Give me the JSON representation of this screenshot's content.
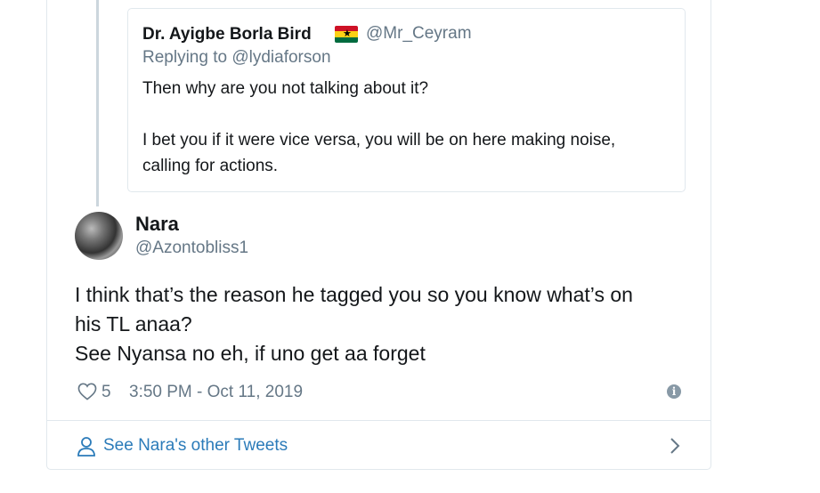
{
  "quoted_tweet": {
    "author_name": "Dr. Ayigbe Borla Bird",
    "flag": "ghana-flag-icon",
    "handle": "@Mr_Ceyram",
    "replying_to": "Replying to @lydiaforson",
    "text_line1": "Then why are you not talking about it?",
    "text_line2": "I bet you if it were vice versa, you will be on here making noise,",
    "text_line3": "calling for actions."
  },
  "tweet": {
    "author_name": "Nara",
    "handle": "@Azontobliss1",
    "text_line1": "I think that’s the reason he tagged you so you know what’s on",
    "text_line2": "his TL anaa?",
    "text_line3": "See Nyansa no eh, if uno get aa forget",
    "likes": "5",
    "timestamp": "3:50 PM - Oct 11, 2019"
  },
  "footer": {
    "see_more_label": "See Nara's other Tweets"
  },
  "colors": {
    "link": "#2b7bb9",
    "secondary_text": "#657786",
    "border": "#e1e8ed"
  }
}
